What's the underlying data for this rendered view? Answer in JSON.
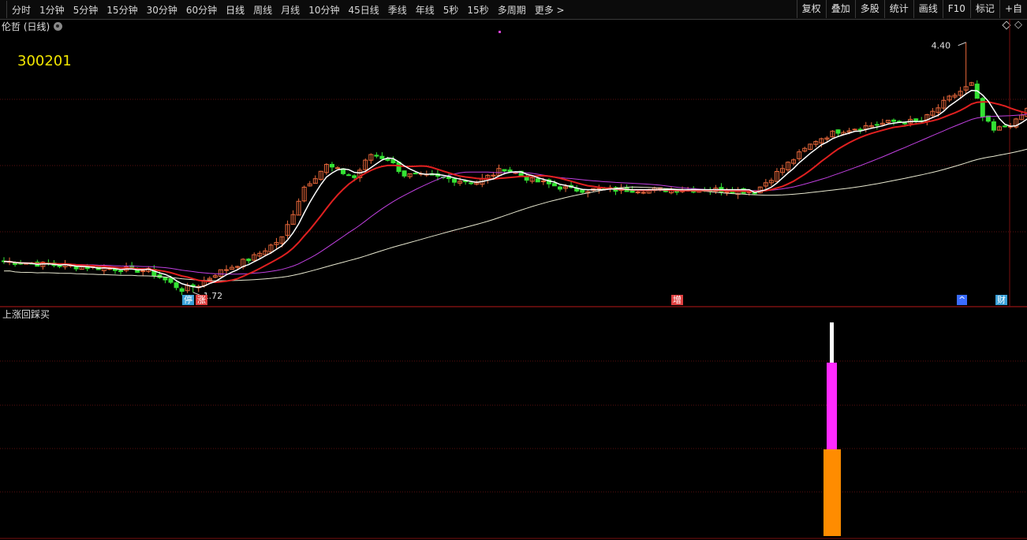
{
  "toolbar": {
    "periods": [
      "分时",
      "1分钟",
      "5分钟",
      "15分钟",
      "30分钟",
      "60分钟",
      "日线",
      "周线",
      "月线",
      "10分钟",
      "45日线",
      "季线",
      "年线",
      "5秒",
      "15秒",
      "多周期",
      "更多 >"
    ],
    "active": "日线",
    "actions": [
      "复权",
      "叠加",
      "多股",
      "统计",
      "画线",
      "F10",
      "标记",
      "+自"
    ]
  },
  "chart_title": "伦哲 (日线)",
  "stock_code": "300201",
  "price_labels": {
    "high": "4.40",
    "low": "1.72"
  },
  "markers": [
    {
      "text": "停",
      "color": "#3aa0d8"
    },
    {
      "text": "涨",
      "color": "#e04040"
    },
    {
      "text": "增",
      "color": "#e04040"
    },
    {
      "text": "^",
      "color": "#3a6cff"
    },
    {
      "text": "财",
      "color": "#3aa0d8"
    }
  ],
  "sub_chart_title": "上涨回踩买",
  "colors": {
    "up": "#e8673a",
    "down": "#34e234",
    "ma_short": "#ffffff",
    "ma_mid": "#e02020",
    "ma_long": "#c040e0",
    "ma_longest": "#e8e8d0",
    "grid": "#5a1010",
    "sub_white": "#ffffff",
    "sub_magenta": "#ff2aff",
    "sub_orange": "#ff8c00"
  },
  "chart_data": {
    "type": "candlestick",
    "price_range": [
      1.6,
      4.6
    ],
    "high": 4.4,
    "low": 1.72,
    "indicator": {
      "name": "上涨回踩买",
      "segments": [
        "white",
        "magenta",
        "orange"
      ]
    }
  }
}
